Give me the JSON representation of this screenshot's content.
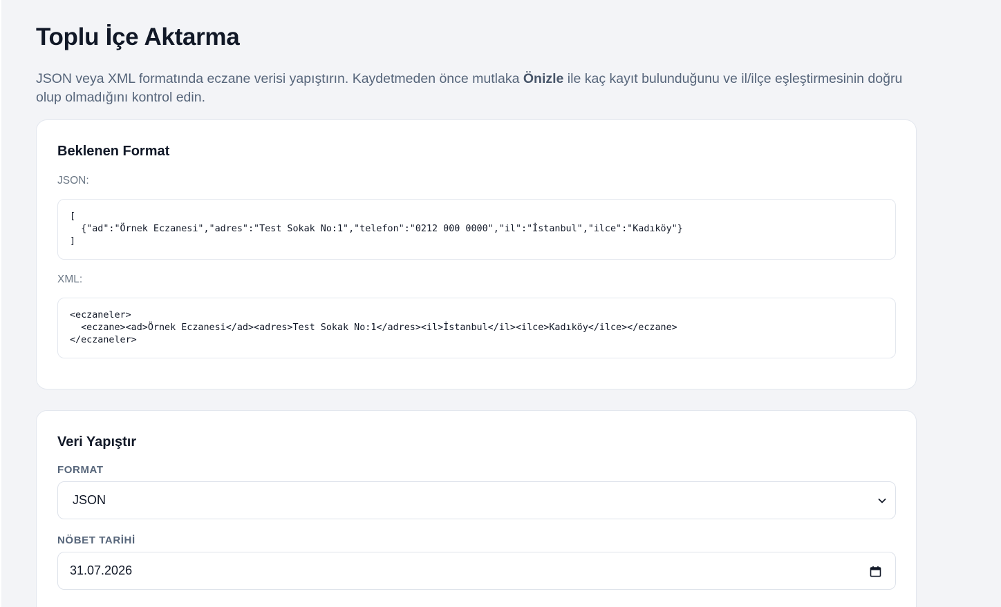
{
  "page": {
    "title": "Toplu İçe Aktarma",
    "intro_before": "JSON veya XML formatında eczane verisi yapıştırın. Kaydetmeden önce mutlaka ",
    "intro_bold": "Önizle",
    "intro_after": " ile kaç kayıt bulunduğunu ve il/ilçe eşleştirmesinin doğru olup olmadığını kontrol edin."
  },
  "format_card": {
    "title": "Beklenen Format",
    "json_label": "JSON:",
    "json_example": "[\n  {\"ad\":\"Örnek Eczanesi\",\"adres\":\"Test Sokak No:1\",\"telefon\":\"0212 000 0000\",\"il\":\"İstanbul\",\"ilce\":\"Kadıköy\"}\n]",
    "xml_label": "XML:",
    "xml_example": "<eczaneler>\n  <eczane><ad>Örnek Eczanesi</ad><adres>Test Sokak No:1</adres><il>İstanbul</il><ilce>Kadıköy</ilce></eczane>\n</eczaneler>"
  },
  "paste_card": {
    "title": "Veri Yapıştır",
    "format_label": "FORMAT",
    "format_value": "JSON",
    "date_label": "NÖBET TARİHİ",
    "date_value": "31.07.2026"
  },
  "icons": {
    "select": "chevron-down-icon",
    "date": "calendar-icon"
  },
  "colors": {
    "background": "#f3f4f7",
    "card": "#ffffff",
    "border": "#e3e7ee",
    "muted_text": "#56657a"
  }
}
